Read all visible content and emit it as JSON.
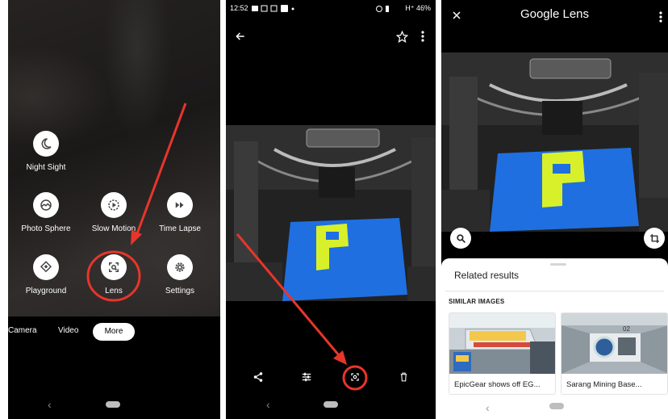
{
  "camera_menu": {
    "modes": [
      {
        "label": "Night Sight",
        "icon": "moon-icon"
      },
      {
        "label": "Photo Sphere",
        "icon": "photo-sphere-icon"
      },
      {
        "label": "Slow Motion",
        "icon": "slow-motion-icon"
      },
      {
        "label": "Time Lapse",
        "icon": "time-lapse-icon"
      },
      {
        "label": "Playground",
        "icon": "playground-icon"
      },
      {
        "label": "Lens",
        "icon": "lens-icon"
      },
      {
        "label": "Settings",
        "icon": "settings-icon"
      }
    ],
    "tabs": {
      "camera": "Camera",
      "video": "Video",
      "more": "More"
    }
  },
  "photo_viewer": {
    "status": {
      "time": "12:52",
      "right": "H⁺ 46%"
    },
    "actions": [
      "share-icon",
      "edit-icon",
      "lens-icon",
      "delete-icon"
    ]
  },
  "lens": {
    "title": "Google Lens",
    "related_title": "Related results",
    "similar_label": "SIMILAR IMAGES",
    "results": [
      {
        "caption": "EpicGear shows off EG..."
      },
      {
        "caption": "Sarang Mining Base..."
      }
    ]
  },
  "colors": {
    "annotation_red": "#e8352b",
    "print_blue": "#1f6fe0",
    "print_yellow": "#d8f02a"
  }
}
